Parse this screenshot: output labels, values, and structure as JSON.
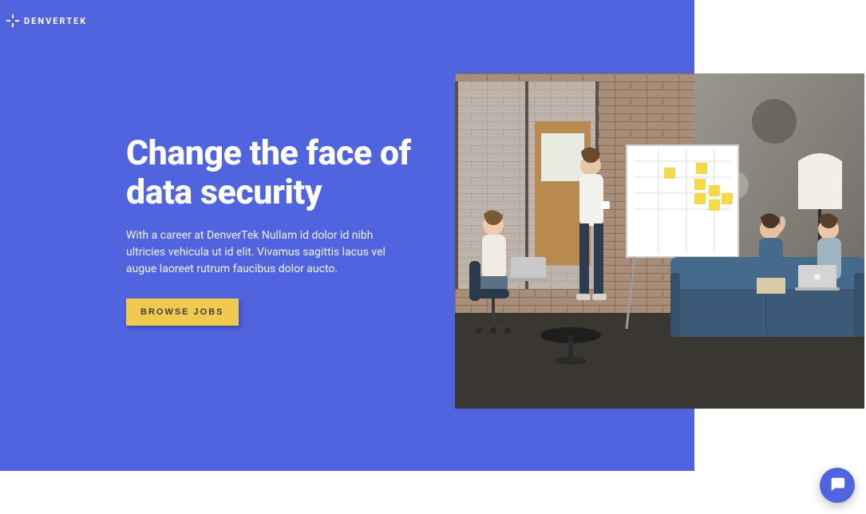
{
  "brand": {
    "name": "DENVERTEK"
  },
  "hero": {
    "title": "Change the face of data security",
    "subtitle": "With a career at DenverTek Nullam id dolor id nibh ultricies vehicula ut id elit. Vivamus sagittis lacus vel augue laoreet rutrum faucibus dolor aucto.",
    "cta_label": "BROWSE JOBS"
  },
  "colors": {
    "primary": "#5164e0",
    "accent": "#f0ca4f"
  }
}
